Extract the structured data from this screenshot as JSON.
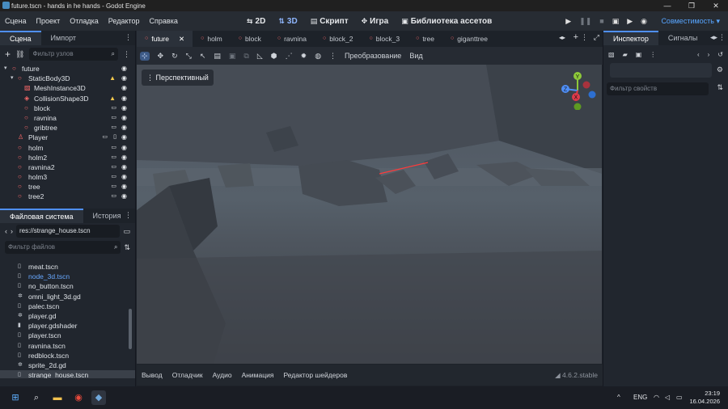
{
  "window": {
    "title": "future.tscn - hands in he hands - Godot Engine",
    "controls": [
      "—",
      "❐",
      "✕"
    ]
  },
  "menu": [
    "Сцена",
    "Проект",
    "Отладка",
    "Редактор",
    "Справка"
  ],
  "workspaces": [
    {
      "label": "2D",
      "icon": "2d-icon"
    },
    {
      "label": "3D",
      "icon": "3d-icon",
      "active": true
    },
    {
      "label": "Скрипт",
      "icon": "script-icon"
    },
    {
      "label": "Игра",
      "icon": "game-icon"
    },
    {
      "label": "Библиотека ассетов",
      "icon": "asset-library-icon"
    }
  ],
  "renderer_label": "Совместимость",
  "scene_dock": {
    "tabs": [
      "Сцена",
      "Импорт"
    ],
    "filter_placeholder": "Фильтр узлов",
    "nodes": [
      {
        "label": "future",
        "depth": 0,
        "icon": "node3d-icon",
        "color": "#ff6a6a",
        "expanded": true
      },
      {
        "label": "StaticBody3D",
        "depth": 1,
        "icon": "staticbody-icon",
        "color": "#ff6a6a",
        "expanded": true,
        "warning": true
      },
      {
        "label": "MeshInstance3D",
        "depth": 2,
        "icon": "mesh-icon",
        "color": "#ff6a6a"
      },
      {
        "label": "CollisionShape3D",
        "depth": 2,
        "icon": "collision-icon",
        "color": "#ff6a6a",
        "warning": true
      },
      {
        "label": "block",
        "depth": 1,
        "icon": "scene-icon",
        "color": "#ff6a6a",
        "instance": true
      },
      {
        "label": "ravnina",
        "depth": 1,
        "icon": "scene-icon",
        "color": "#ff6a6a",
        "instance": true
      },
      {
        "label": "gribtree",
        "depth": 1,
        "icon": "scene-icon",
        "color": "#ff6a6a",
        "instance": true
      },
      {
        "label": "Player",
        "depth": 0,
        "icon": "player-icon",
        "color": "#ff6a6a",
        "instance": true,
        "script": true
      },
      {
        "label": "holm",
        "depth": 0,
        "icon": "scene-icon",
        "color": "#ff6a6a",
        "instance": true
      },
      {
        "label": "holm2",
        "depth": 0,
        "icon": "scene-icon",
        "color": "#ff6a6a",
        "instance": true
      },
      {
        "label": "ravnina2",
        "depth": 0,
        "icon": "scene-icon",
        "color": "#ff6a6a",
        "instance": true
      },
      {
        "label": "holm3",
        "depth": 0,
        "icon": "scene-icon",
        "color": "#ff6a6a",
        "instance": true
      },
      {
        "label": "tree",
        "depth": 0,
        "icon": "scene-icon",
        "color": "#ff6a6a",
        "instance": true
      },
      {
        "label": "tree2",
        "depth": 0,
        "icon": "scene-icon",
        "color": "#ff6a6a",
        "instance": true
      }
    ]
  },
  "fs_dock": {
    "tabs": [
      "Файловая система",
      "История"
    ],
    "path": "res://strange_house.tscn",
    "filter_placeholder": "Фильтр файлов",
    "files": [
      {
        "label": "meat.tscn",
        "icon": "scene-file-icon"
      },
      {
        "label": "node_3d.tscn",
        "icon": "scene-file-icon",
        "highlight": true
      },
      {
        "label": "no_button.tscn",
        "icon": "scene-file-icon"
      },
      {
        "label": "omni_light_3d.gd",
        "icon": "gear-icon"
      },
      {
        "label": "palec.tscn",
        "icon": "scene-file-icon"
      },
      {
        "label": "player.gd",
        "icon": "gear-icon"
      },
      {
        "label": "player.gdshader",
        "icon": "shader-icon"
      },
      {
        "label": "player.tscn",
        "icon": "scene-file-icon"
      },
      {
        "label": "ravnina.tscn",
        "icon": "scene-file-icon"
      },
      {
        "label": "redblock.tscn",
        "icon": "scene-file-icon"
      },
      {
        "label": "sprite_2d.gd",
        "icon": "gear-icon"
      },
      {
        "label": "strange_house.tscn",
        "icon": "scene-file-icon",
        "selected": true
      }
    ]
  },
  "editor_tabs": [
    "future",
    "holm",
    "block",
    "ravnina",
    "block_2",
    "block_3",
    "tree",
    "giganttree"
  ],
  "toolbar3d": {
    "transform_menu": "Преобразование",
    "view_menu": "Вид"
  },
  "viewport": {
    "perspective_label": "Перспективный",
    "gizmo": {
      "y": "Y",
      "x": "X",
      "z": "Z"
    }
  },
  "bottom_panel": {
    "items": [
      "Вывод",
      "Отладчик",
      "Аудио",
      "Анимация",
      "Редактор шейдеров"
    ],
    "version": "4.6.2.stable"
  },
  "inspector": {
    "tabs": [
      "Инспектор",
      "Сигналы"
    ],
    "filter_placeholder": "Фильтр свойств"
  },
  "taskbar": {
    "language": "ENG",
    "time": "23:19",
    "date": "16.04.2026"
  }
}
